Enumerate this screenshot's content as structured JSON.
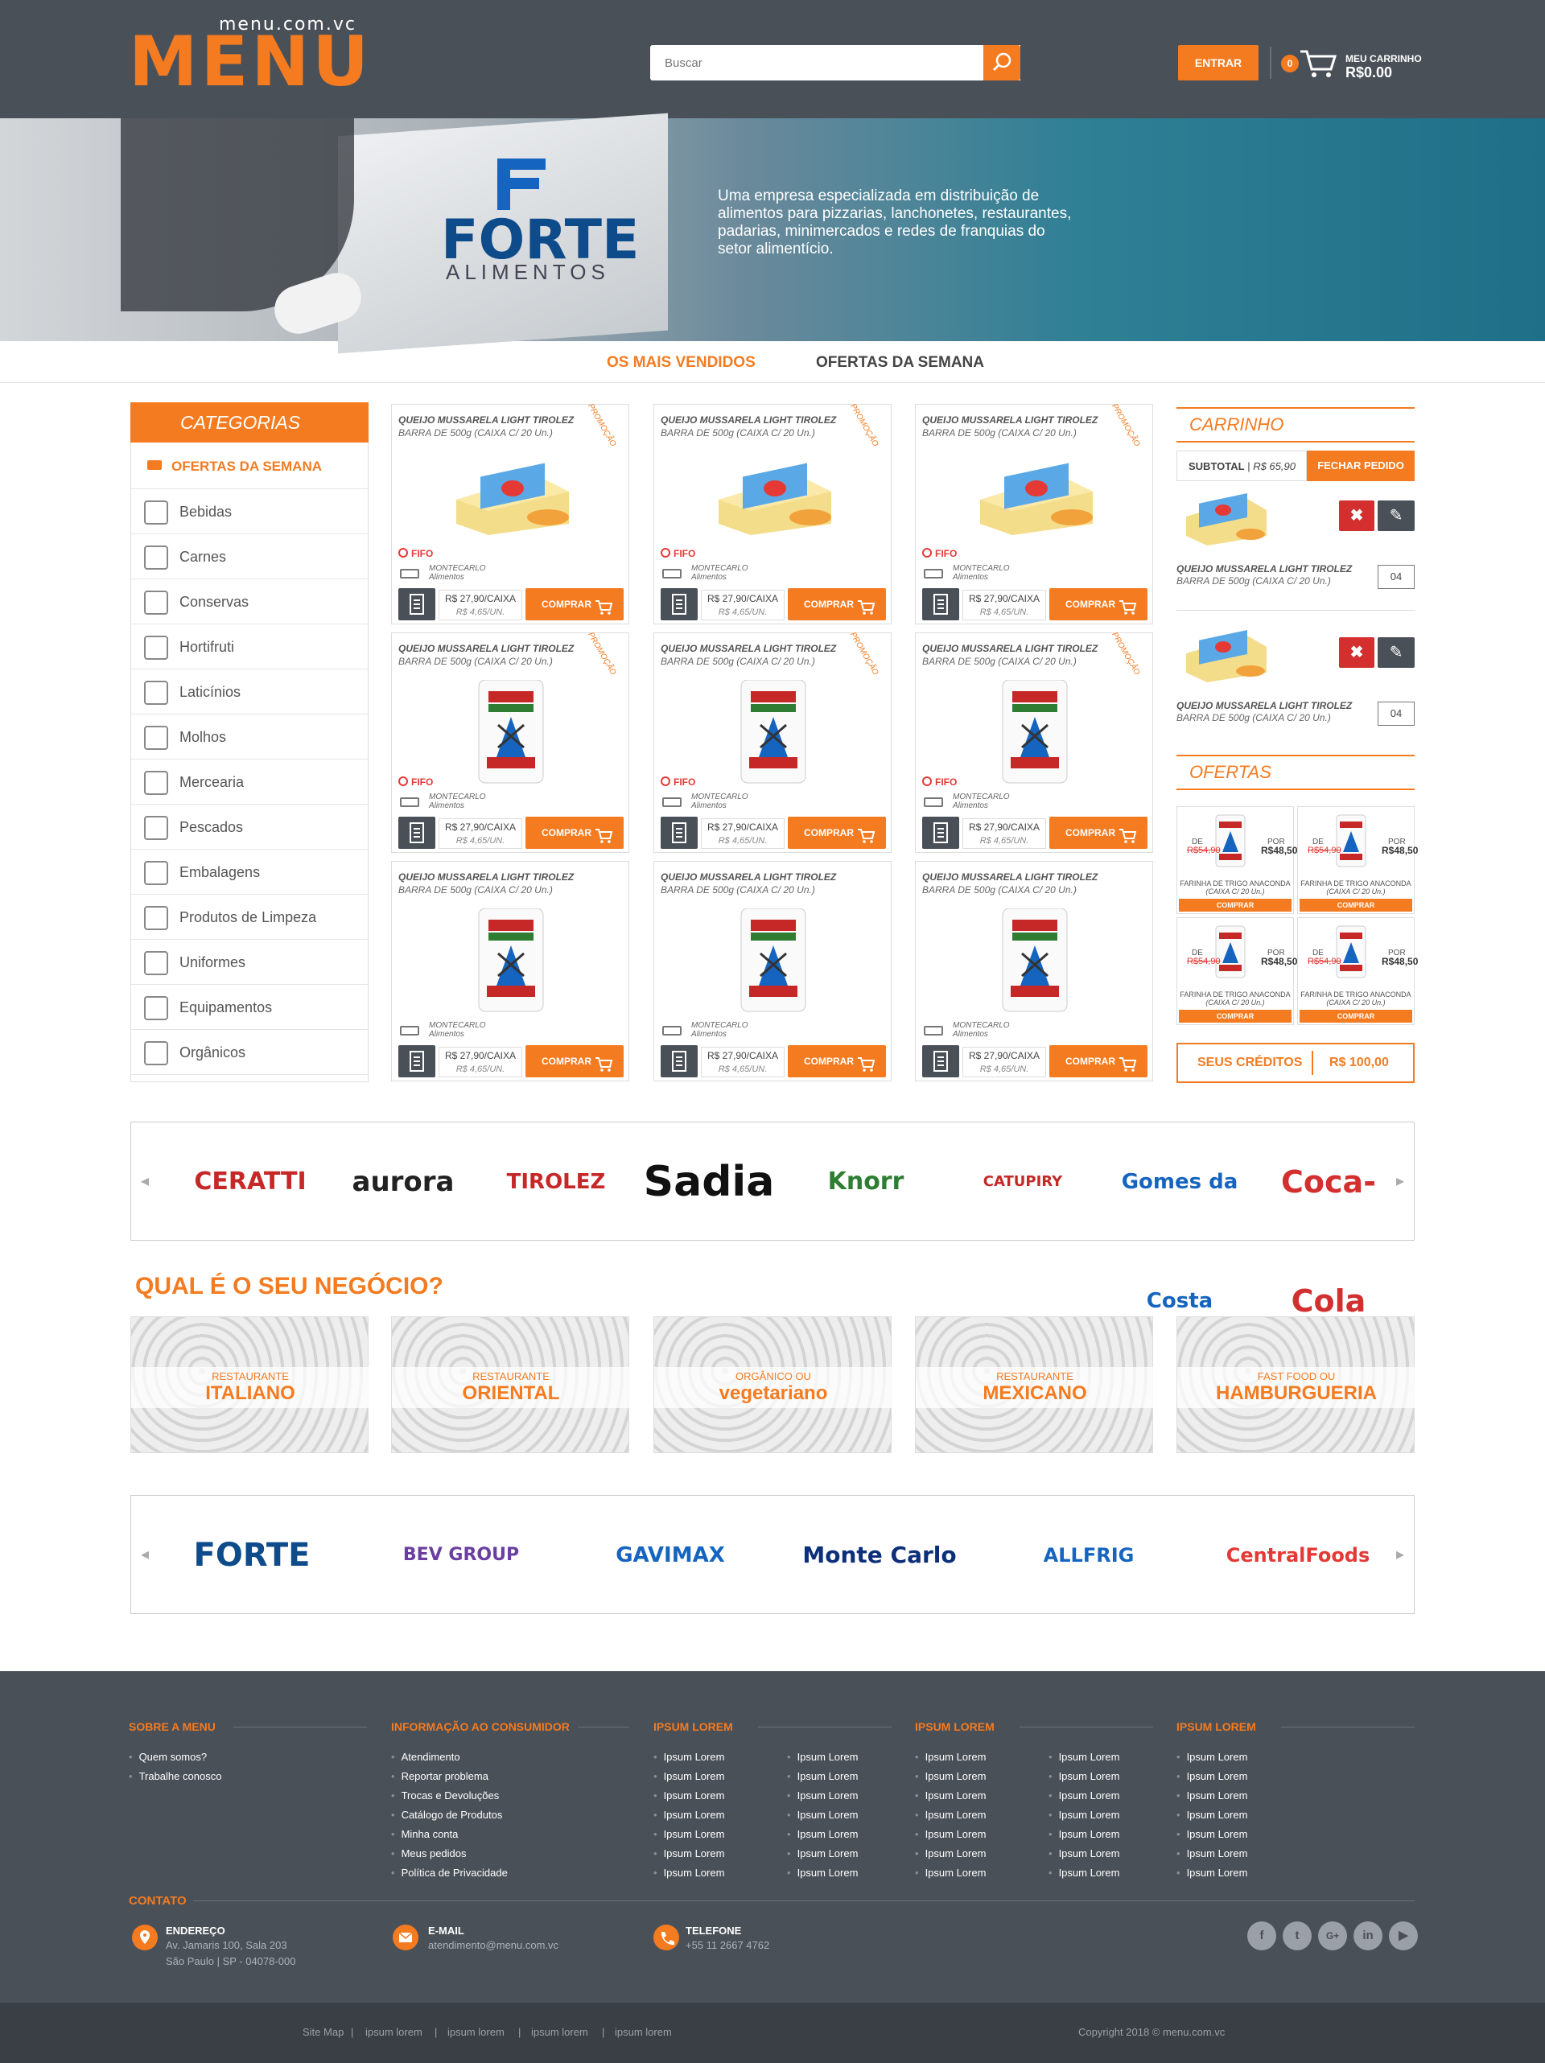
{
  "header": {
    "logo_sub": "menu.com.vc",
    "logo_word": "MENU",
    "search_placeholder": "Buscar",
    "login_label": "ENTRAR",
    "cart_count": "0",
    "cart_label": "MEU CARRINHO",
    "cart_total": "R$0.00"
  },
  "banner": {
    "brand": "FORTE",
    "brand_sub": "ALIMENTOS",
    "text": "Uma empresa especializada em distribuição de alimentos para pizzarias, lanchonetes, restaurantes, padarias, minimercados e redes de franquias do setor alimentício."
  },
  "tabs": [
    "OS MAIS VENDIDOS",
    "OFERTAS DA SEMANA"
  ],
  "categories": {
    "title": "CATEGORIAS",
    "featured": "OFERTAS DA SEMANA",
    "items": [
      "Bebidas",
      "Carnes",
      "Conservas",
      "Hortifruti",
      "Laticínios",
      "Molhos",
      "Mercearia",
      "Pescados",
      "Embalagens",
      "Produtos de Limpeza",
      "Uniformes",
      "Equipamentos",
      "Orgânicos"
    ]
  },
  "products": [
    {
      "name": "QUEIJO MUSSARELA LIGHT TIROLEZ",
      "desc": "BARRA DE 500g (CAIXA C/ 20 Un.)",
      "promo": "PROMOÇÃO",
      "fifo": "FIFO",
      "supplier": "MONTECARLO",
      "supplier2": "Alimentos",
      "price": "R$ 27,90/CAIXA",
      "unit": "R$ 4,65/UN.",
      "buy": "COMPRAR",
      "img": "cheese"
    },
    {
      "name": "QUEIJO MUSSARELA LIGHT TIROLEZ",
      "desc": "BARRA DE 500g (CAIXA C/ 20 Un.)",
      "promo": "PROMOÇÃO",
      "fifo": "FIFO",
      "supplier": "MONTECARLO",
      "supplier2": "Alimentos",
      "price": "R$ 27,90/CAIXA",
      "unit": "R$ 4,65/UN.",
      "buy": "COMPRAR",
      "img": "cheese"
    },
    {
      "name": "QUEIJO MUSSARELA LIGHT TIROLEZ",
      "desc": "BARRA DE 500g (CAIXA C/ 20 Un.)",
      "promo": "PROMOÇÃO",
      "fifo": "FIFO",
      "supplier": "MONTECARLO",
      "supplier2": "Alimentos",
      "price": "R$ 27,90/CAIXA",
      "unit": "R$ 4,65/UN.",
      "buy": "COMPRAR",
      "img": "cheese"
    },
    {
      "name": "QUEIJO MUSSARELA LIGHT TIROLEZ",
      "desc": "BARRA DE 500g (CAIXA C/ 20 Un.)",
      "promo": "PROMOÇÃO",
      "fifo": "FIFO",
      "supplier": "MONTECARLO",
      "supplier2": "Alimentos",
      "price": "R$ 27,90/CAIXA",
      "unit": "R$ 4,65/UN.",
      "buy": "COMPRAR",
      "img": "flour"
    },
    {
      "name": "QUEIJO MUSSARELA LIGHT TIROLEZ",
      "desc": "BARRA DE 500g (CAIXA C/ 20 Un.)",
      "promo": "PROMOÇÃO",
      "fifo": "FIFO",
      "supplier": "MONTECARLO",
      "supplier2": "Alimentos",
      "price": "R$ 27,90/CAIXA",
      "unit": "R$ 4,65/UN.",
      "buy": "COMPRAR",
      "img": "flour"
    },
    {
      "name": "QUEIJO MUSSARELA LIGHT TIROLEZ",
      "desc": "BARRA DE 500g (CAIXA C/ 20 Un.)",
      "promo": "PROMOÇÃO",
      "fifo": "FIFO",
      "supplier": "MONTECARLO",
      "supplier2": "Alimentos",
      "price": "R$ 27,90/CAIXA",
      "unit": "R$ 4,65/UN.",
      "buy": "COMPRAR",
      "img": "flour"
    },
    {
      "name": "QUEIJO MUSSARELA LIGHT TIROLEZ",
      "desc": "BARRA DE 500g (CAIXA C/ 20 Un.)",
      "promo": "",
      "fifo": "",
      "supplier": "MONTECARLO",
      "supplier2": "Alimentos",
      "price": "R$ 27,90/CAIXA",
      "unit": "R$ 4,65/UN.",
      "buy": "COMPRAR",
      "img": "flour"
    },
    {
      "name": "QUEIJO MUSSARELA LIGHT TIROLEZ",
      "desc": "BARRA DE 500g (CAIXA C/ 20 Un.)",
      "promo": "",
      "fifo": "",
      "supplier": "MONTECARLO",
      "supplier2": "Alimentos",
      "price": "R$ 27,90/CAIXA",
      "unit": "R$ 4,65/UN.",
      "buy": "COMPRAR",
      "img": "flour"
    },
    {
      "name": "QUEIJO MUSSARELA LIGHT TIROLEZ",
      "desc": "BARRA DE 500g (CAIXA C/ 20 Un.)",
      "promo": "",
      "fifo": "",
      "supplier": "MONTECARLO",
      "supplier2": "Alimentos",
      "price": "R$ 27,90/CAIXA",
      "unit": "R$ 4,65/UN.",
      "buy": "COMPRAR",
      "img": "flour"
    }
  ],
  "cart": {
    "title": "CARRINHO",
    "subtotal_label": "SUBTOTAL",
    "subtotal_value": "R$ 65,90",
    "close_label": "FECHAR PEDIDO",
    "items": [
      {
        "name": "QUEIJO MUSSARELA LIGHT TIROLEZ",
        "desc": "BARRA DE 500g (CAIXA C/ 20 Un.)",
        "qty": "04",
        "del": "✖",
        "edit": "✎"
      },
      {
        "name": "QUEIJO MUSSARELA LIGHT TIROLEZ",
        "desc": "BARRA DE 500g (CAIXA C/ 20 Un.)",
        "qty": "04",
        "del": "✖",
        "edit": "✎"
      }
    ]
  },
  "offers": {
    "title": "OFERTAS",
    "items": [
      {
        "de": "DE",
        "old": "R$54,90",
        "por": "POR",
        "new": "R$48,50",
        "name": "FARINHA DE TRIGO ANACONDA",
        "desc": "(CAIXA C/ 20 Un.)",
        "buy": "COMPRAR"
      },
      {
        "de": "DE",
        "old": "R$54,90",
        "por": "POR",
        "new": "R$48,50",
        "name": "FARINHA DE TRIGO ANACONDA",
        "desc": "(CAIXA C/ 20 Un.)",
        "buy": "COMPRAR"
      },
      {
        "de": "DE",
        "old": "R$54,90",
        "por": "POR",
        "new": "R$48,50",
        "name": "FARINHA DE TRIGO ANACONDA",
        "desc": "(CAIXA C/ 20 Un.)",
        "buy": "COMPRAR"
      },
      {
        "de": "DE",
        "old": "R$54,90",
        "por": "POR",
        "new": "R$48,50",
        "name": "FARINHA DE TRIGO ANACONDA",
        "desc": "(CAIXA C/ 20 Un.)",
        "buy": "COMPRAR"
      }
    ]
  },
  "credits": {
    "label": "SEUS CRÉDITOS",
    "value": "R$ 100,00"
  },
  "brands": {
    "row1": [
      "CERATTI",
      "aurora",
      "TIROLEZ",
      "Sadia",
      "Knorr",
      "CATUPIRY",
      "Gomes da Costa",
      "Coca-Cola"
    ],
    "row1_colors": [
      "#c62828",
      "#222222",
      "#c62828",
      "#111111",
      "#2e7d32",
      "#c62828",
      "#1565c0",
      "#d32f2f"
    ],
    "row2": [
      "FORTE",
      "BEV GROUP",
      "GAVIMAX",
      "Monte Carlo",
      "ALLFRIG",
      "CentralFoods"
    ],
    "row2_colors": [
      "#0e4b8a",
      "#6a3fa0",
      "#1565c0",
      "#0d2f7a",
      "#1565c0",
      "#e53935"
    ]
  },
  "business": {
    "title": "QUAL É O SEU NEGÓCIO?",
    "items": [
      {
        "pre": "RESTAURANTE",
        "main": "ITALIANO"
      },
      {
        "pre": "RESTAURANTE",
        "main": "ORIENTAL"
      },
      {
        "pre": "ORGÂNICO OU",
        "main": "vegetariano"
      },
      {
        "pre": "RESTAURANTE",
        "main": "MEXICANO"
      },
      {
        "pre": "FAST FOOD OU",
        "main": "HAMBURGUERIA"
      }
    ]
  },
  "footer": {
    "cols": [
      {
        "title": "SOBRE A MENU",
        "items": [
          "Quem somos?",
          "Trabalhe conosco"
        ],
        "items2": []
      },
      {
        "title": "INFORMAÇÃO AO CONSUMIDOR",
        "items": [
          "Atendimento",
          "Reportar problema",
          "Trocas e Devoluções",
          "Catálogo de Produtos",
          "Minha conta",
          "Meus pedidos",
          "Política de Privacidade"
        ],
        "items2": []
      },
      {
        "title": "IPSUM LOREM",
        "items": [
          "Ipsum Lorem",
          "Ipsum Lorem",
          "Ipsum Lorem",
          "Ipsum Lorem",
          "Ipsum Lorem",
          "Ipsum Lorem",
          "Ipsum Lorem"
        ],
        "items2": [
          "Ipsum Lorem",
          "Ipsum Lorem",
          "Ipsum Lorem",
          "Ipsum Lorem",
          "Ipsum Lorem",
          "Ipsum Lorem",
          "Ipsum Lorem"
        ]
      },
      {
        "title": "IPSUM LOREM",
        "items": [
          "Ipsum Lorem",
          "Ipsum Lorem",
          "Ipsum Lorem",
          "Ipsum Lorem",
          "Ipsum Lorem",
          "Ipsum Lorem",
          "Ipsum Lorem"
        ],
        "items2": [
          "Ipsum Lorem",
          "Ipsum Lorem",
          "Ipsum Lorem",
          "Ipsum Lorem",
          "Ipsum Lorem",
          "Ipsum Lorem",
          "Ipsum Lorem"
        ]
      },
      {
        "title": "IPSUM LOREM",
        "items": [
          "Ipsum Lorem",
          "Ipsum Lorem",
          "Ipsum Lorem",
          "Ipsum Lorem",
          "Ipsum Lorem",
          "Ipsum Lorem",
          "Ipsum Lorem"
        ],
        "items2": []
      }
    ],
    "contact": {
      "title": "CONTATO",
      "address_label": "ENDEREÇO",
      "address_line1": "Av. Jamaris 100, Sala 203",
      "address_line2": "São Paulo | SP - 04078-000",
      "email_label": "E-MAIL",
      "email": "atendimento@menu.com.vc",
      "phone_label": "TELEFONE",
      "phone": "+55 11 2667 4762"
    },
    "social": [
      "f",
      "t",
      "G+",
      "in",
      "▶"
    ],
    "bottom_links": [
      "Site Map",
      "|",
      "ipsum lorem",
      "|",
      "ipsum lorem",
      "|",
      "ipsum lorem",
      "|",
      "ipsum lorem"
    ],
    "copyright": "Copyright 2018 © menu.com.vc"
  },
  "colors": {
    "accent": "#f47b20",
    "header_bg": "#4a5058",
    "footer_bottom": "#3a3f46",
    "danger": "#d32f2f"
  },
  "icons": [
    "search-icon",
    "cart-icon",
    "list-icon",
    "truck-icon",
    "clock-icon",
    "trash-icon",
    "edit-icon",
    "facebook-icon",
    "twitter-icon",
    "google-plus-icon",
    "linkedin-icon",
    "youtube-icon",
    "map-pin-icon",
    "mail-icon",
    "phone-icon"
  ]
}
